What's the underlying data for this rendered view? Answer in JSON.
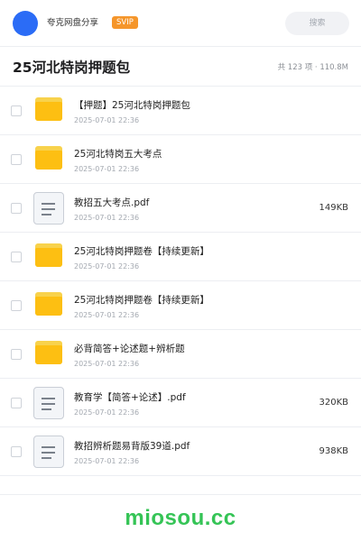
{
  "header": {
    "owner_name": "夸克网盘分享",
    "badge": "SVIP",
    "search_placeholder": "搜索"
  },
  "folder": {
    "title": "25河北特岗押题包",
    "summary": "共 123 项 · 110.8M"
  },
  "files": [
    {
      "name": "【押题】25河北特岗押题包",
      "date": "2025-07-01 22:36",
      "type": "folder",
      "size": ""
    },
    {
      "name": "25河北特岗五大考点",
      "date": "2025-07-01 22:36",
      "type": "folder",
      "size": ""
    },
    {
      "name": "教招五大考点.pdf",
      "date": "2025-07-01 22:36",
      "type": "pdf",
      "size": "149KB"
    },
    {
      "name": "25河北特岗押题卷【持续更新】",
      "date": "2025-07-01 22:36",
      "type": "folder",
      "size": ""
    },
    {
      "name": "25河北特岗押题卷【持续更新】",
      "date": "2025-07-01 22:36",
      "type": "folder",
      "size": ""
    },
    {
      "name": "必背简答+论述题+辨析题",
      "date": "2025-07-01 22:36",
      "type": "folder",
      "size": ""
    },
    {
      "name": "教育学【简答+论述】.pdf",
      "date": "2025-07-01 22:36",
      "type": "pdf",
      "size": "320KB"
    },
    {
      "name": "教招辨析题易背版39道.pdf",
      "date": "2025-07-01 22:36",
      "type": "pdf",
      "size": "938KB"
    }
  ],
  "footer": {
    "watermark": "miosou.cc"
  },
  "colors": {
    "avatar": "#2b6cf6",
    "svip_badge": "#f5962b",
    "folder_icon": "#fdbf12",
    "watermark": "#35c456"
  }
}
